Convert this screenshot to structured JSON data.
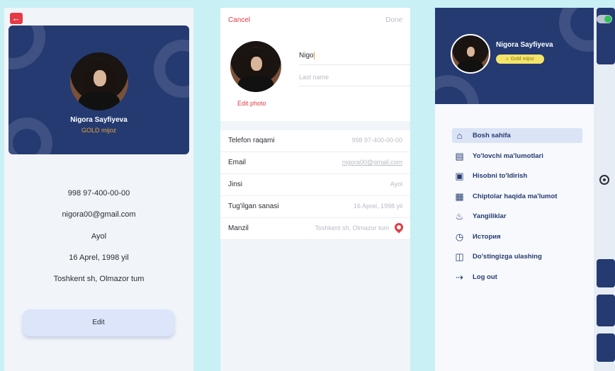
{
  "profile": {
    "name": "Nigora Sayfiyeva",
    "tier": "GOLD mijoz",
    "phone": "998 97-400-00-00",
    "email": "nigora00@gmail.com",
    "gender": "Ayol",
    "birthday": "16 Aprel, 1998 yil",
    "address": "Toshkent sh, Olmazor tum",
    "edit_label": "Edit",
    "back_icon": "arrow-left-icon"
  },
  "edit": {
    "cancel_label": "Cancel",
    "done_label": "Done",
    "edit_photo_label": "Edit photo",
    "first_name_value": "Nigo",
    "last_name_placeholder": "Last name",
    "fields": [
      {
        "label": "Telefon raqami",
        "value": "998 97-400-00-00"
      },
      {
        "label": "Email",
        "value": "nigora00@gmail.com"
      },
      {
        "label": "Jinsi",
        "value": "Ayol"
      },
      {
        "label": "Tug'ilgan sanasi",
        "value": "16 Aprel, 1998 yil"
      },
      {
        "label": "Manzil",
        "value": "Toshkent sh, Olmazor tum"
      }
    ]
  },
  "drawer": {
    "name": "Nigora Sayfiyeva",
    "badge": "Gold mijoz",
    "items": [
      {
        "label": "Bosh sahifa",
        "icon": "home-icon",
        "active": true
      },
      {
        "label": "Yo'lovchi ma'lumotlari",
        "icon": "document-icon",
        "active": false
      },
      {
        "label": "Hisobni to'ldirish",
        "icon": "wallet-icon",
        "active": false
      },
      {
        "label": "Chiptolar haqida ma'lumot",
        "icon": "ticket-icon",
        "active": false
      },
      {
        "label": "Yangiliklar",
        "icon": "bell-icon",
        "active": false
      },
      {
        "label": "История",
        "icon": "history-icon",
        "active": false
      },
      {
        "label": "Do'stingizga ulashing",
        "icon": "gift-icon",
        "active": false
      },
      {
        "label": "Log out",
        "icon": "logout-icon",
        "active": false
      }
    ]
  },
  "colors": {
    "navy": "#243a71",
    "accent": "#e63946",
    "gold": "#e6a23c"
  }
}
